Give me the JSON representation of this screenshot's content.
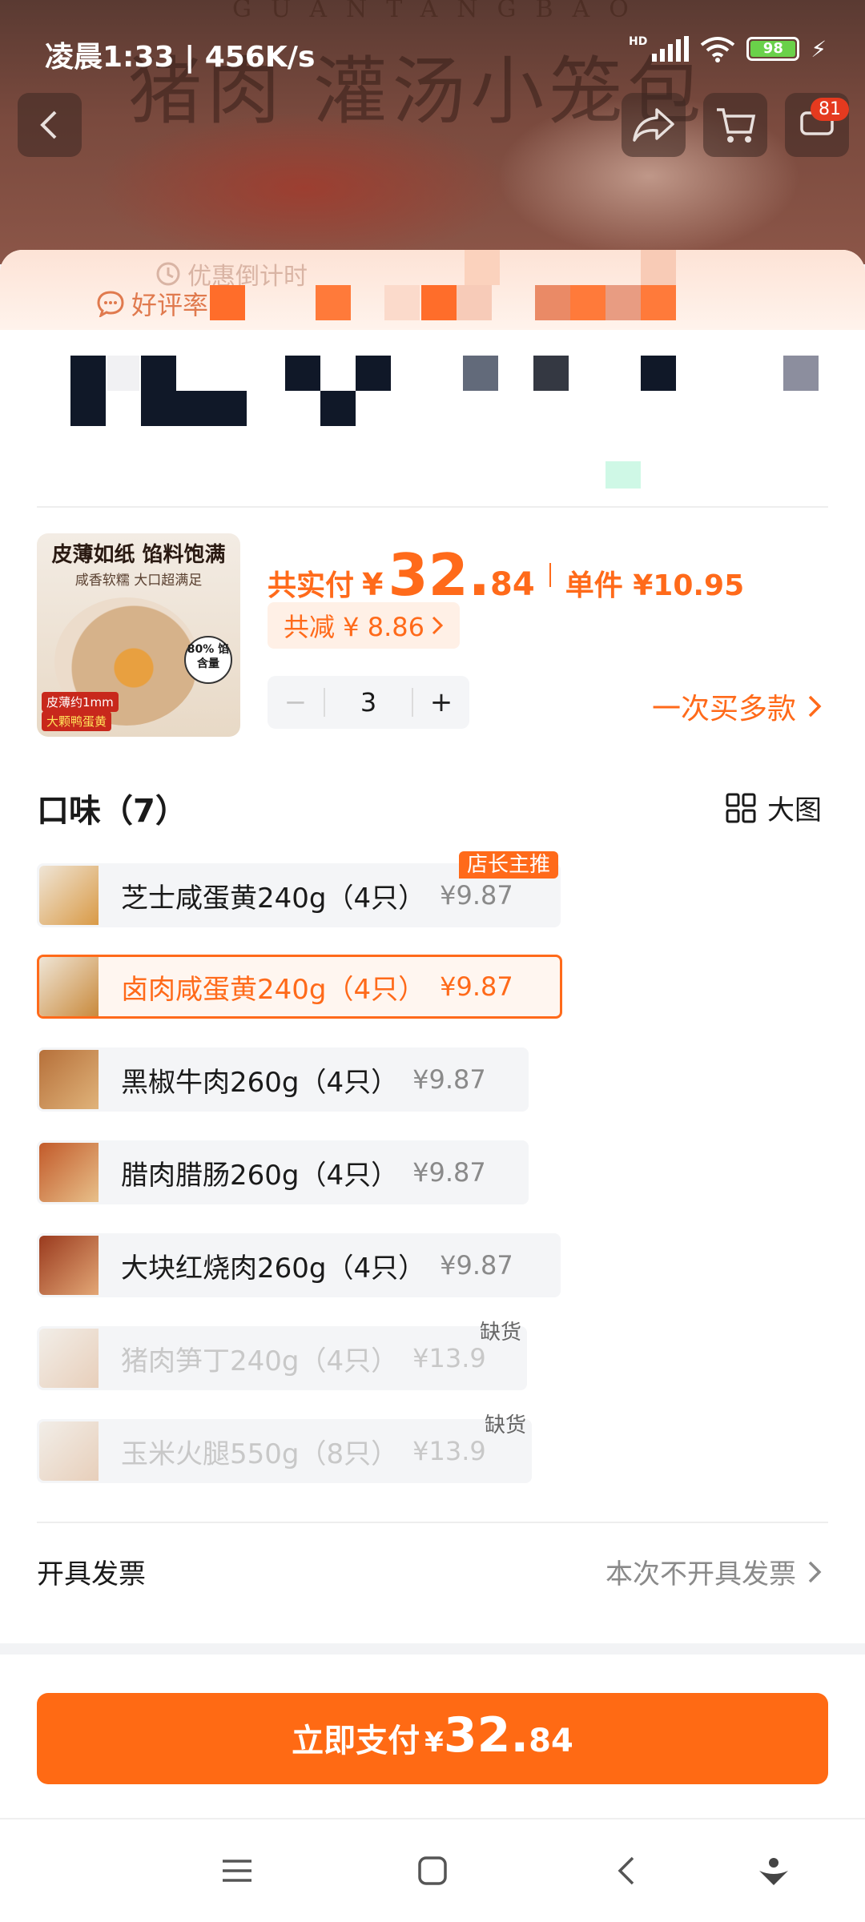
{
  "status_bar": {
    "time": "凌晨1:33 | 456K/s",
    "network": "HD",
    "battery": "98"
  },
  "banner": {
    "title": "猪肉 灌汤小笼包",
    "subtitle": "GUANTANGBAO"
  },
  "top_nav": {
    "cart_badge": "81"
  },
  "promo": {
    "countdown": "优惠倒计时",
    "good_review": "好评率"
  },
  "order": {
    "total_label": "共实付",
    "currency": "¥",
    "total_int": "32.",
    "total_dec": "84",
    "unit_price": "单件 ¥10.95",
    "discount": "共减 ¥ 8.86",
    "quantity": "3",
    "minus": "−",
    "plus": "+",
    "multi_buy": "一次买多款"
  },
  "product_image": {
    "headline": "皮薄如纸 馅料饱满",
    "subline": "咸香软糯 大口超满足",
    "filling_badge": "80% 馅含量",
    "tag_skin": "皮薄约1mm",
    "tag_yolk": "大颗鸭蛋黄"
  },
  "flavors": {
    "title": "口味（7）",
    "big_view": "大图",
    "options": [
      {
        "name": "芝士咸蛋黄240g（4只）",
        "price": "¥9.87",
        "tag": "店长主推",
        "state": "normal"
      },
      {
        "name": "卤肉咸蛋黄240g（4只）",
        "price": "¥9.87",
        "tag": "",
        "state": "selected"
      },
      {
        "name": "黑椒牛肉260g（4只）",
        "price": "¥9.87",
        "tag": "",
        "state": "normal"
      },
      {
        "name": "腊肉腊肠260g（4只）",
        "price": "¥9.87",
        "tag": "",
        "state": "normal"
      },
      {
        "name": "大块红烧肉260g（4只）",
        "price": "¥9.87",
        "tag": "",
        "state": "normal"
      },
      {
        "name": "猪肉笋丁240g（4只）",
        "price": "¥13.9",
        "tag": "缺货",
        "state": "out_of_stock"
      },
      {
        "name": "玉米火腿550g（8只）",
        "price": "¥13.9",
        "tag": "缺货",
        "state": "out_of_stock"
      }
    ]
  },
  "invoice": {
    "label": "开具发票",
    "value": "本次不开具发票"
  },
  "pay": {
    "label": "立即支付",
    "currency": "¥",
    "int": "32.",
    "dec": "84"
  },
  "colors": {
    "accent": "#ff6a14",
    "selected_bg": "#fff6f0",
    "option_bg": "#f4f5f7"
  }
}
